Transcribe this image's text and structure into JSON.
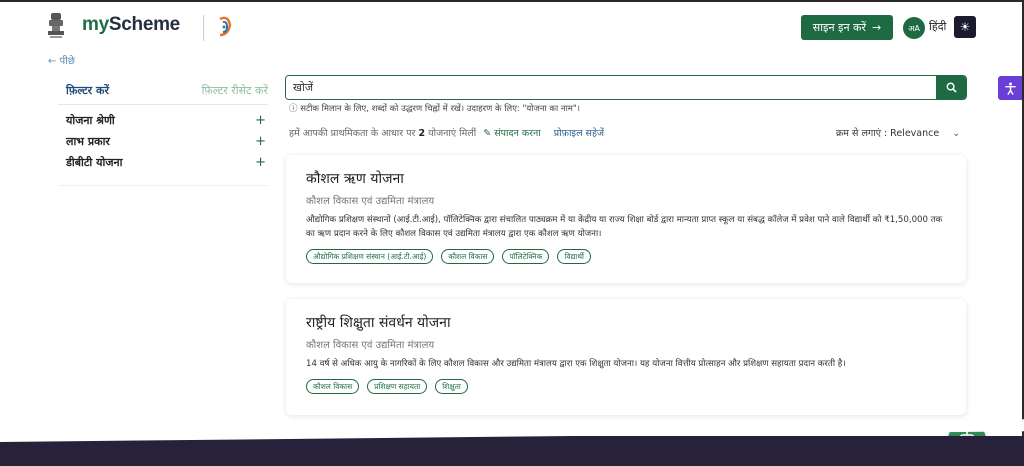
{
  "header": {
    "brand_part1": "my",
    "brand_part2": "Scheme",
    "signin_label": "साइन इन करें",
    "signin_arrow": "→",
    "lang_icon": "अA",
    "lang_label": "हिंदी",
    "theme_icon": "☀"
  },
  "nav": {
    "back_label": "← पीछे"
  },
  "filters": {
    "title": "फ़िल्टर करें",
    "reset_label": "फ़िल्टर रीसेट करें",
    "items": [
      {
        "label": "योजना श्रेणी",
        "icon": "+"
      },
      {
        "label": "लाभ प्रकार",
        "icon": "+"
      },
      {
        "label": "डीबीटी योजना",
        "icon": "+"
      }
    ]
  },
  "search": {
    "placeholder": "खोजें",
    "hint": "ⓘ सटीक मिलान के लिए, शब्दों को उद्धरण चिह्नों में रखें। उदाहरण के लिए: \"योजना का नाम\"।"
  },
  "results": {
    "prefix": "हमें आपकी प्राथमिकता के आधार पर",
    "count": "2",
    "suffix": "योजनाएं मिलीं",
    "edit_label": "✎ संपादन करना",
    "save_profile_label": "प्रोफ़ाइल सहेजें",
    "sort_label": "क्रम से लगाएं : Relevance",
    "sort_chevron": "⌄"
  },
  "schemes": [
    {
      "title": "कौशल ऋण योजना",
      "ministry": "कौशल विकास एवं उद्यमिता मंत्रालय",
      "description": "औद्योगिक प्रशिक्षण संस्थानों (आई.टी.आई), पॉलिटेक्निक द्वारा संचालित पाठ्यक्रम में या केंद्रीय या राज्य शिक्षा बोर्ड द्वारा मान्यता प्राप्त स्कूल या संबद्ध कॉलेज में प्रवेश पाने वाले विद्यार्थी को ₹1,50,000 तक का ऋण प्रदान करने के लिए कौशल विकास एवं उद्यमिता मंत्रालय द्वारा एक कौशल ऋण योजना।",
      "tags": [
        "औद्योगिक प्रशिक्षण संस्थान (आई.टी.आई)",
        "कौशल विकास",
        "पॉलिटेक्निक",
        "विद्यार्थी"
      ]
    },
    {
      "title": "राष्ट्रीय शिक्षुता संवर्धन योजना",
      "ministry": "कौशल विकास एवं उद्यमिता मंत्रालय",
      "description": "14 वर्ष से अधिक आयु के नागरिकों के लिए कौशल विकास और उद्यमिता मंत्रालय द्वारा एक शिक्षुता योजना। यह योजना वित्तीय प्रोत्साहन और प्रशिक्षण सहायता प्रदान करती है।",
      "tags": [
        "कौशल विकास",
        "प्रशिक्षण सहायता",
        "शिक्षुता"
      ]
    }
  ],
  "colors": {
    "brand_green": "#1e6b43",
    "dark_navy": "#243040",
    "accessibility_purple": "#6a3fd8"
  },
  "icons": {
    "search": "search-icon",
    "accessibility": "accessibility-icon",
    "chat": "chatbot-icon",
    "emblem": "national-emblem-icon",
    "digital_india": "digital-india-logo"
  }
}
